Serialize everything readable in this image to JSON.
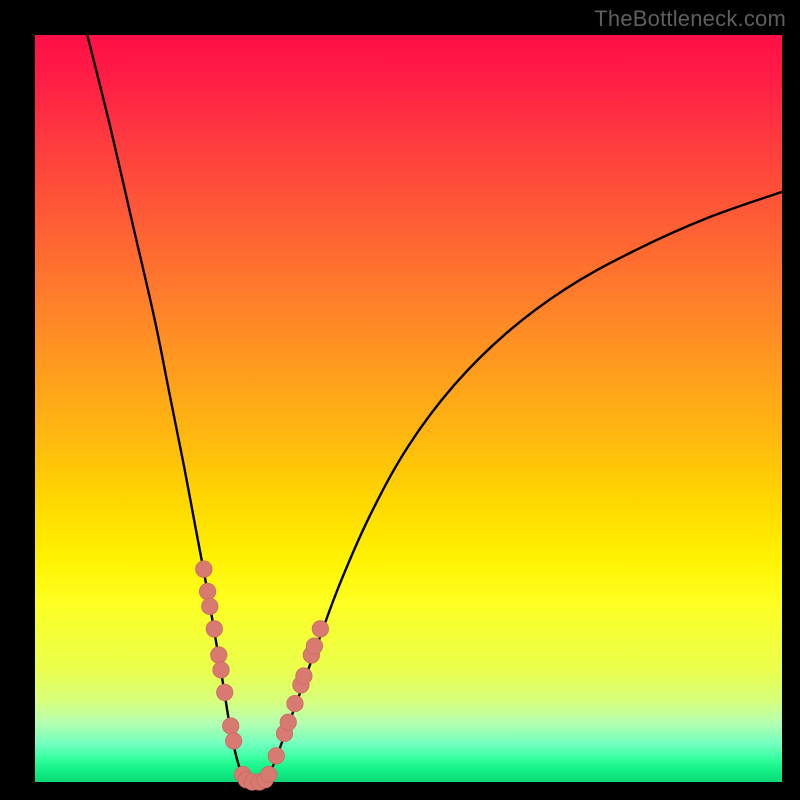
{
  "watermark": "TheBottleneck.com",
  "colors": {
    "background": "#000000",
    "curve_stroke": "#000000",
    "marker_fill": "#d97a72",
    "marker_stroke": "#c96a63"
  },
  "chart_data": {
    "type": "line",
    "title": "",
    "xlabel": "",
    "ylabel": "",
    "xlim": [
      0,
      100
    ],
    "ylim": [
      0,
      100
    ],
    "series": [
      {
        "name": "left-branch",
        "x": [
          7,
          10,
          13,
          16,
          18,
          20,
          21.5,
          23,
          24.2,
          25.2,
          26,
          26.8,
          27.5,
          28
        ],
        "y": [
          100,
          88,
          75,
          62,
          52,
          42,
          34,
          26,
          19,
          13,
          8,
          4,
          1.5,
          0.2
        ]
      },
      {
        "name": "valley-floor",
        "x": [
          28,
          28.7,
          29.5,
          30.3,
          31
        ],
        "y": [
          0.2,
          0,
          0,
          0,
          0.2
        ]
      },
      {
        "name": "right-branch",
        "x": [
          31,
          32,
          33.5,
          35.5,
          38,
          41,
          45,
          50,
          56,
          63,
          71,
          80,
          90,
          100
        ],
        "y": [
          0.2,
          2.5,
          6.5,
          12,
          19,
          27,
          36,
          45,
          53,
          60,
          66,
          71,
          75.5,
          79
        ]
      }
    ],
    "markers": [
      {
        "x": 22.6,
        "y": 28.5
      },
      {
        "x": 23.1,
        "y": 25.5
      },
      {
        "x": 23.4,
        "y": 23.5
      },
      {
        "x": 24.0,
        "y": 20.5
      },
      {
        "x": 24.6,
        "y": 17.0
      },
      {
        "x": 24.9,
        "y": 15.0
      },
      {
        "x": 25.4,
        "y": 12.0
      },
      {
        "x": 26.2,
        "y": 7.5
      },
      {
        "x": 26.6,
        "y": 5.5
      },
      {
        "x": 27.8,
        "y": 1.0
      },
      {
        "x": 28.3,
        "y": 0.3
      },
      {
        "x": 29.1,
        "y": 0.0
      },
      {
        "x": 30.0,
        "y": 0.0
      },
      {
        "x": 30.8,
        "y": 0.3
      },
      {
        "x": 31.3,
        "y": 1.0
      },
      {
        "x": 32.3,
        "y": 3.5
      },
      {
        "x": 33.4,
        "y": 6.5
      },
      {
        "x": 33.9,
        "y": 8.0
      },
      {
        "x": 34.8,
        "y": 10.5
      },
      {
        "x": 35.6,
        "y": 13.0
      },
      {
        "x": 36.0,
        "y": 14.2
      },
      {
        "x": 37.0,
        "y": 17.0
      },
      {
        "x": 37.4,
        "y": 18.2
      },
      {
        "x": 38.2,
        "y": 20.5
      }
    ]
  }
}
